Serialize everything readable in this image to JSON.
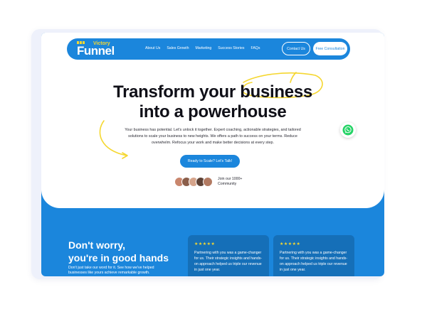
{
  "nav": {
    "logo_main": "Funnel",
    "logo_small": "Victory",
    "links": [
      "About Us",
      "Sales Growth",
      "Marketing",
      "Success Stories",
      "FAQs"
    ],
    "contact_label": "Contact Us",
    "consultation_label": "Free Consultation"
  },
  "hero": {
    "title_line1": "Transform your business",
    "title_line2": "into a powerhouse",
    "paragraph": "Your business has potential. Let's unlock it together. Expert coaching, actionable strategies, and tailored solutions to scale your business to new heights. We offers a path to success on your terms. Reduce overwhelm. Refocus your work and make better decisions at every step.",
    "cta_label": "Ready to Scale? Let's Talk!",
    "community_line1": "Join our 1000+",
    "community_line2": "Community"
  },
  "section": {
    "title_line1": "Don't worry,",
    "title_line2": "you're in good hands",
    "text": "Don't just take our word for it. See how we've helped businesses like yours achieve remarkable growth."
  },
  "testimonials": [
    {
      "stars": "★★★★★",
      "quote": "Partnering with you was a game-changer for us. Their strategic insights and hands-on approach helped us triple our revenue in just one year."
    },
    {
      "stars": "★★★★★",
      "quote": "Partnering with you was a game-changer for us. Their strategic insights and hands-on approach helped us triple our revenue in just one year."
    }
  ],
  "colors": {
    "brand_blue": "#1b86dc",
    "accent_yellow": "#f5d730",
    "whatsapp_green": "#25d366"
  }
}
